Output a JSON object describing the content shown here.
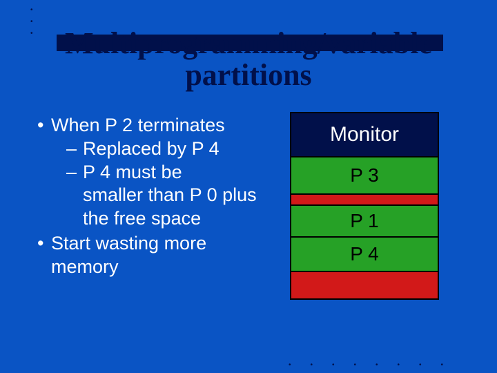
{
  "title_line1": "Multiprogramming/variable",
  "title_line2": "partitions",
  "bullets": {
    "b1a": "When P 2 terminates",
    "b2a": "Replaced by P 4",
    "b2b_prefix": " P 4 must be",
    "b2b_rest": "smaller than P 0 plus the free space",
    "b1b": "Start wasting more memory"
  },
  "memory": {
    "monitor": "Monitor",
    "p3": "P 3",
    "p1": "P 1",
    "p4": "P 4"
  },
  "colors": {
    "background": "#0a54c4",
    "dark": "#01104a",
    "green": "#26a126",
    "red": "#d21919"
  }
}
